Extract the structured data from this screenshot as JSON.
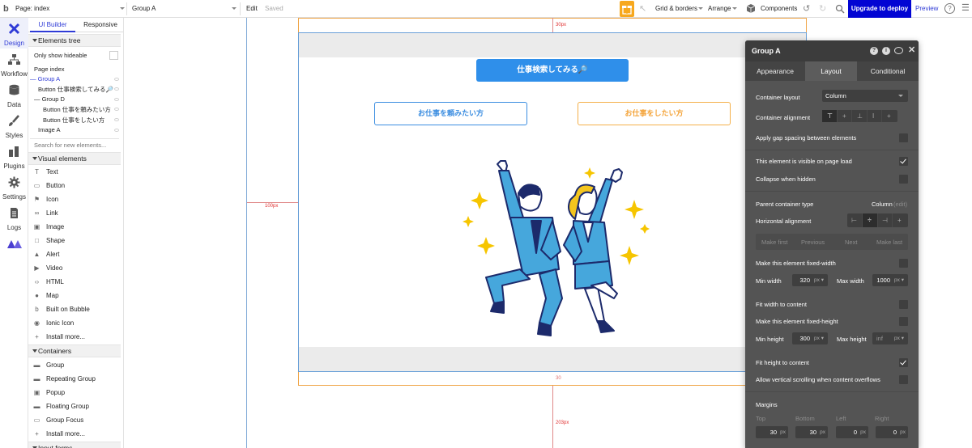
{
  "topbar": {
    "page_label": "Page: index",
    "element_label": "Group A",
    "edit_label": "Edit",
    "saved_label": "Saved",
    "grid_label": "Grid & borders",
    "arrange_label": "Arrange",
    "components_label": "Components",
    "upgrade_label": "Upgrade to deploy",
    "preview_label": "Preview"
  },
  "rail": {
    "items": [
      {
        "label": "Design",
        "icon": "design-icon"
      },
      {
        "label": "Workflow",
        "icon": "workflow-icon"
      },
      {
        "label": "Data",
        "icon": "database-icon"
      },
      {
        "label": "Styles",
        "icon": "brush-icon"
      },
      {
        "label": "Plugins",
        "icon": "plugins-icon"
      },
      {
        "label": "Settings",
        "icon": "gear-icon"
      },
      {
        "label": "Logs",
        "icon": "logs-icon"
      }
    ]
  },
  "palette": {
    "tab_builder": "UI Builder",
    "tab_responsive": "Responsive",
    "elements_tree": "Elements tree",
    "only_hideable": "Only show hideable",
    "tree": [
      {
        "label": "Page index",
        "indent": 0
      },
      {
        "label": "Group A",
        "indent": 0
      },
      {
        "label": "Button 仕事検索してみる🔎",
        "indent": 1
      },
      {
        "label": "Group D",
        "indent": 0
      },
      {
        "label": "Button 仕事を頼みたい方",
        "indent": 2
      },
      {
        "label": "Button 仕事をしたい方",
        "indent": 2
      },
      {
        "label": "Image A",
        "indent": 1
      }
    ],
    "search_placeholder": "Search for new elements...",
    "visual_head": "Visual elements",
    "visual": [
      {
        "label": "Text",
        "icon": "text-icon"
      },
      {
        "label": "Button",
        "icon": "button-icon"
      },
      {
        "label": "Icon",
        "icon": "flag-icon"
      },
      {
        "label": "Link",
        "icon": "link-icon"
      },
      {
        "label": "Image",
        "icon": "image-icon"
      },
      {
        "label": "Shape",
        "icon": "shape-icon"
      },
      {
        "label": "Alert",
        "icon": "bell-icon"
      },
      {
        "label": "Video",
        "icon": "video-icon"
      },
      {
        "label": "HTML",
        "icon": "code-icon"
      },
      {
        "label": "Map",
        "icon": "map-pin-icon"
      },
      {
        "label": "Built on Bubble",
        "icon": "bubble-icon"
      },
      {
        "label": "Ionic Icon",
        "icon": "ionic-icon"
      },
      {
        "label": "Install more...",
        "icon": "plus-icon"
      }
    ],
    "containers_head": "Containers",
    "containers": [
      {
        "label": "Group",
        "icon": "folder-icon"
      },
      {
        "label": "Repeating Group",
        "icon": "folder-icon"
      },
      {
        "label": "Popup",
        "icon": "popup-icon"
      },
      {
        "label": "Floating Group",
        "icon": "folder-icon"
      },
      {
        "label": "Group Focus",
        "icon": "focus-icon"
      },
      {
        "label": "Install more...",
        "icon": "plus-icon"
      }
    ],
    "input_forms_head": "Input forms"
  },
  "canvas": {
    "top_margin_label": "30px",
    "left_margin_label": "100px",
    "bottom_label": "30",
    "bottom_margin_label": "203px",
    "btn_search": "仕事検索してみる🔎",
    "btn_hire": "お仕事を頼みたい方",
    "btn_work": "お仕事をしたい方"
  },
  "props": {
    "title": "Group A",
    "tabs": [
      "Appearance",
      "Layout",
      "Conditional"
    ],
    "container_layout_label": "Container layout",
    "container_layout_value": "Column",
    "container_alignment_label": "Container alignment",
    "gap_label": "Apply gap spacing between elements",
    "visible_label": "This element is visible on page load",
    "collapse_label": "Collapse when hidden",
    "parent_type_label": "Parent container type",
    "parent_type_value": "Column",
    "parent_type_edit": "(edit)",
    "h_align_label": "Horizontal alignment",
    "order": [
      "Make first",
      "Previous",
      "Next",
      "Make last"
    ],
    "fixed_width_label": "Make this element fixed-width",
    "min_width_label": "Min width",
    "min_width_value": "320",
    "max_width_label": "Max width",
    "max_width_value": "1000",
    "unit_px": "px",
    "fit_width_label": "Fit width to content",
    "fixed_height_label": "Make this element fixed-height",
    "min_height_label": "Min height",
    "min_height_value": "300",
    "max_height_label": "Max height",
    "max_height_value": "inf",
    "fit_height_label": "Fit height to content",
    "vscroll_label": "Allow vertical scrolling when content overflows",
    "margins_label": "Margins",
    "margin_top_label": "Top",
    "margin_bottom_label": "Bottom",
    "margin_left_label": "Left",
    "margin_right_label": "Right",
    "margin_top": "30",
    "margin_bottom": "30",
    "margin_left": "0",
    "margin_right": "0"
  }
}
